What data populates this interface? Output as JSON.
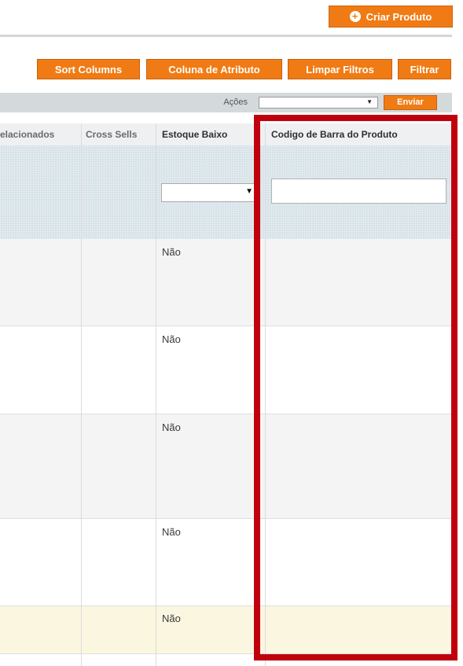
{
  "toolbar": {
    "create_product_label": "Criar Produto",
    "sort_columns_label": "Sort Columns",
    "attribute_column_label": "Coluna de Atributo",
    "clear_filters_label": "Limpar Filtros",
    "filter_label": "Filtrar"
  },
  "actions": {
    "label": "Ações",
    "selected_value": "",
    "submit_label": "Enviar"
  },
  "table": {
    "headers": [
      "elacionados",
      "Cross Sells",
      "Estoque Baixo",
      "Codigo de Barra do Produto"
    ],
    "rows": [
      {
        "estoque_baixo": "Não"
      },
      {
        "estoque_baixo": "Não"
      },
      {
        "estoque_baixo": "Não"
      },
      {
        "estoque_baixo": "Não"
      },
      {
        "estoque_baixo": "Não"
      }
    ]
  },
  "colors": {
    "accent": "#f07b14",
    "highlight": "#c1000d",
    "filter_row": "#d5e2e7",
    "selected_row": "#fbf6e0"
  },
  "icons": {
    "create": "plus-circle-icon",
    "dropdown": "chevron-down-icon"
  }
}
